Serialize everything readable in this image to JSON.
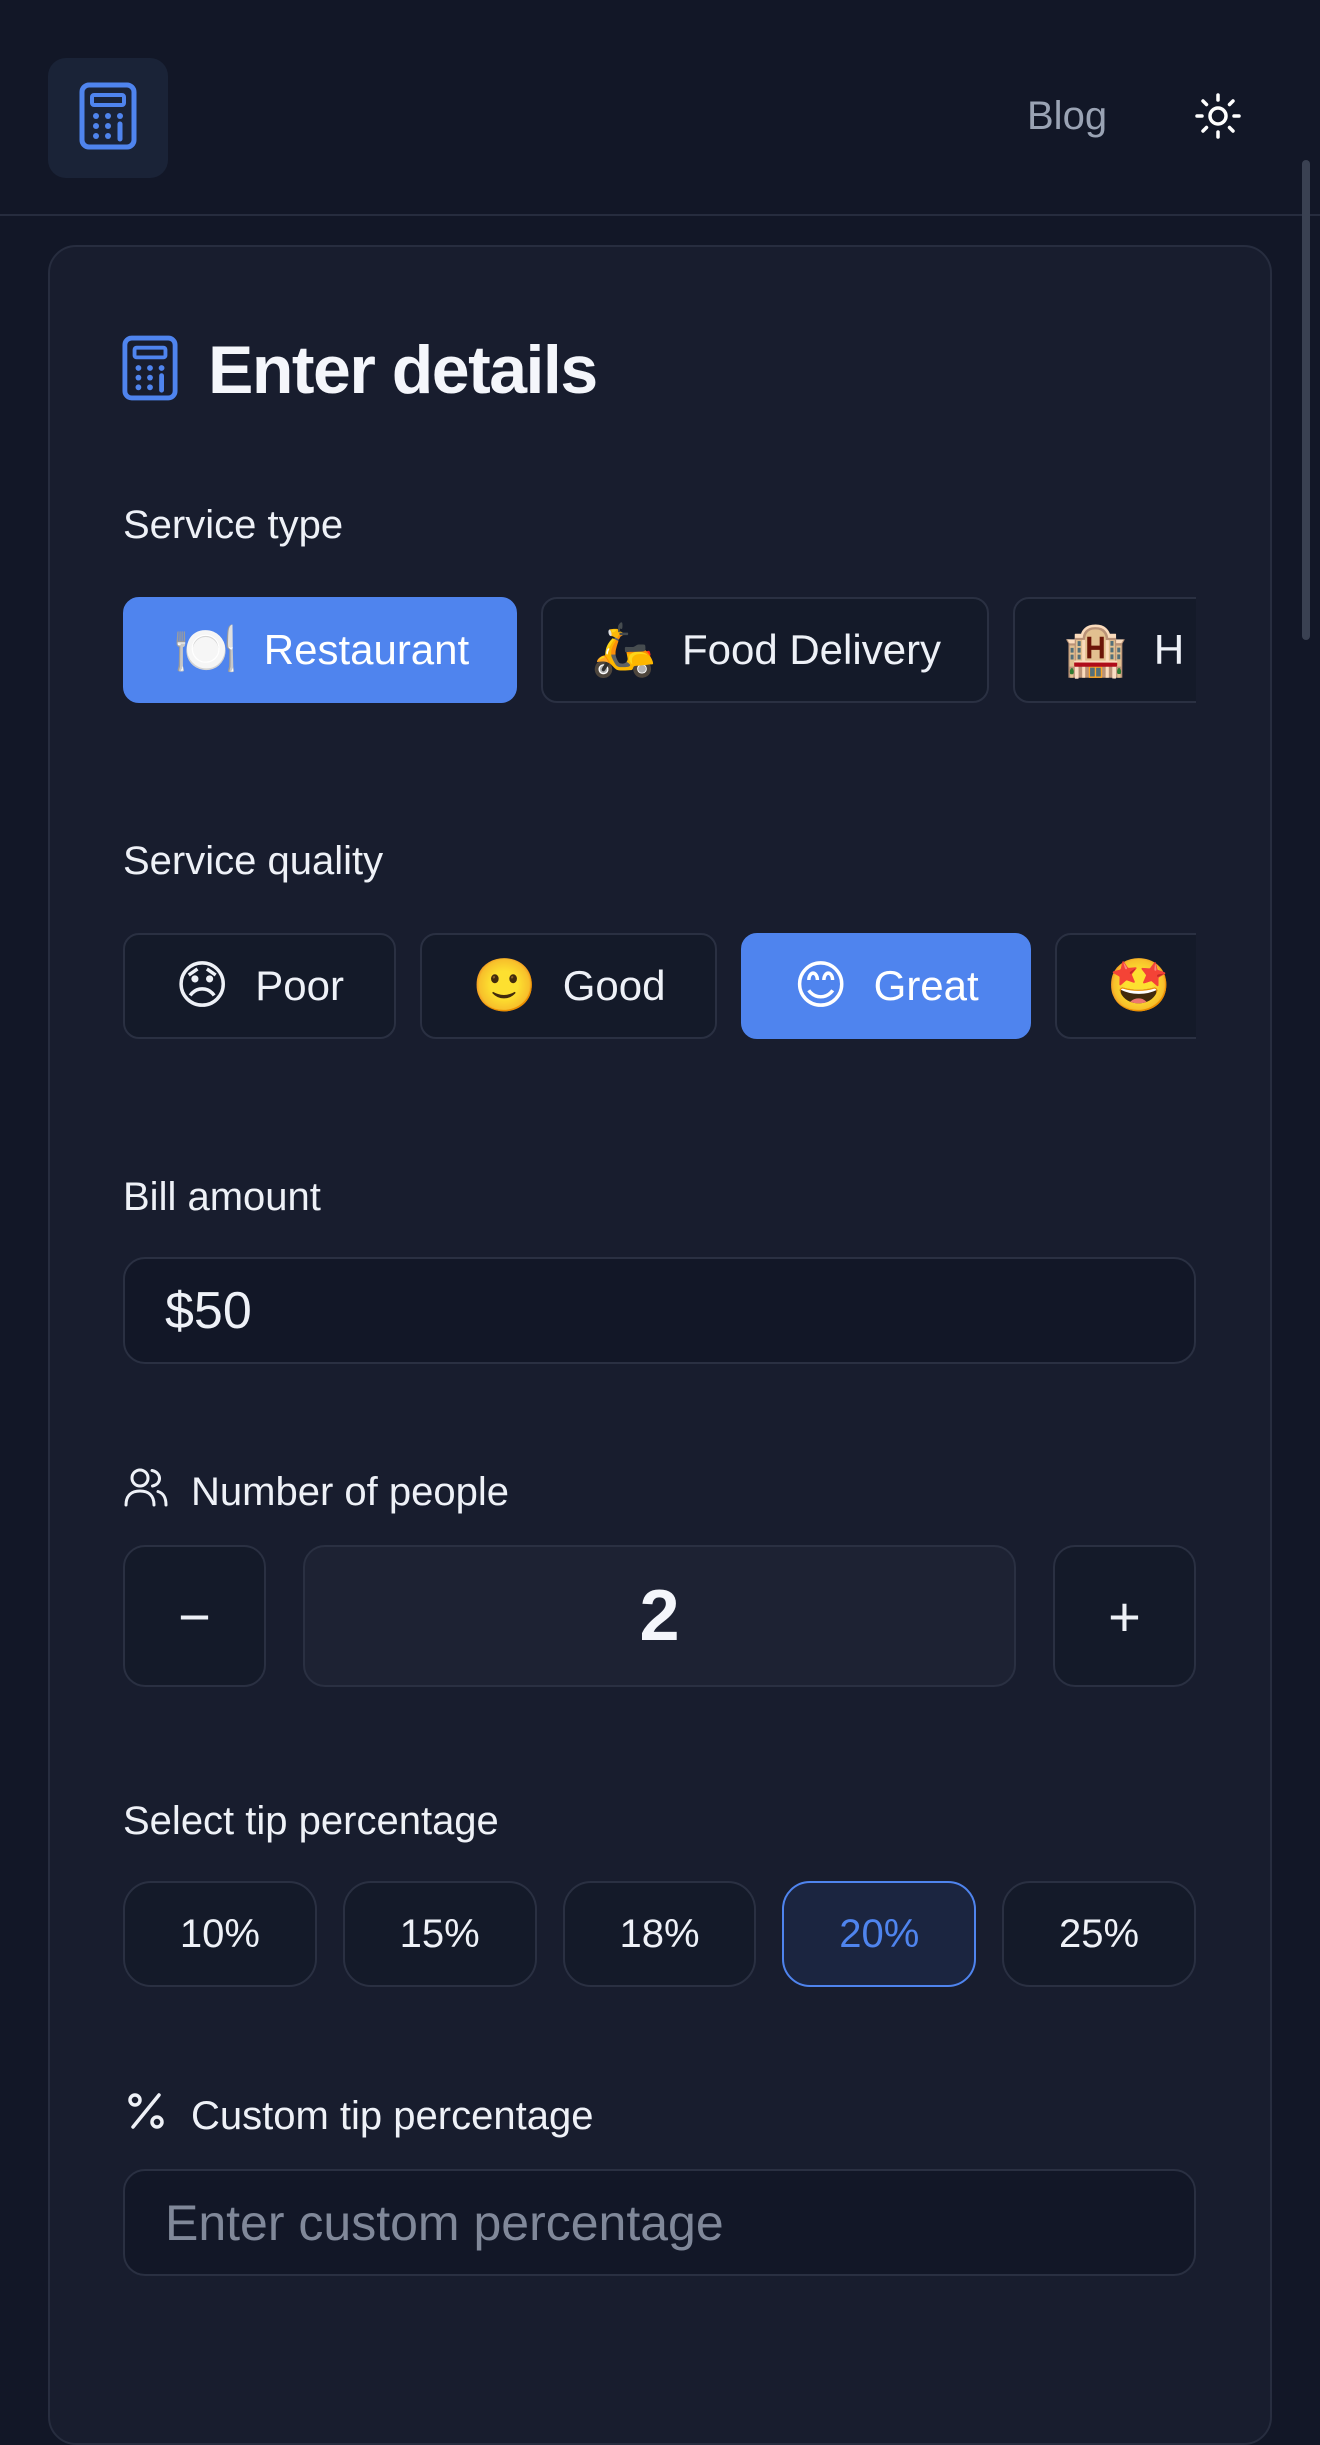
{
  "header": {
    "logo_icon": "calculator-icon",
    "blog_label": "Blog",
    "theme_icon": "sun-icon"
  },
  "card": {
    "title": "Enter details",
    "title_icon": "calculator-icon"
  },
  "service_type": {
    "label": "Service type",
    "options": [
      {
        "emoji": "🍽️",
        "label": "Restaurant",
        "selected": true
      },
      {
        "emoji": "🛵",
        "label": "Food Delivery",
        "selected": false
      },
      {
        "emoji": "🏨",
        "label": "H",
        "selected": false
      }
    ]
  },
  "service_quality": {
    "label": "Service quality",
    "options": [
      {
        "emoji": "😞",
        "label": "Poor",
        "selected": false
      },
      {
        "emoji": "🙂",
        "label": "Good",
        "selected": false
      },
      {
        "emoji": "😊",
        "label": "Great",
        "selected": true
      },
      {
        "emoji": "🤩",
        "label": "",
        "selected": false
      }
    ]
  },
  "bill": {
    "label": "Bill amount",
    "value": "$50"
  },
  "people": {
    "label": "Number of people",
    "icon": "users-icon",
    "decrement_label": "−",
    "increment_label": "+",
    "value": "2"
  },
  "tip": {
    "label": "Select tip percentage",
    "options": [
      "10%",
      "15%",
      "18%",
      "20%",
      "25%"
    ],
    "selected": "20%"
  },
  "custom_tip": {
    "label": "Custom tip percentage",
    "icon": "percent-icon",
    "placeholder": "Enter custom percentage"
  },
  "colors": {
    "accent": "#4f84ee",
    "background": "#121727",
    "card": "#181d2e"
  }
}
